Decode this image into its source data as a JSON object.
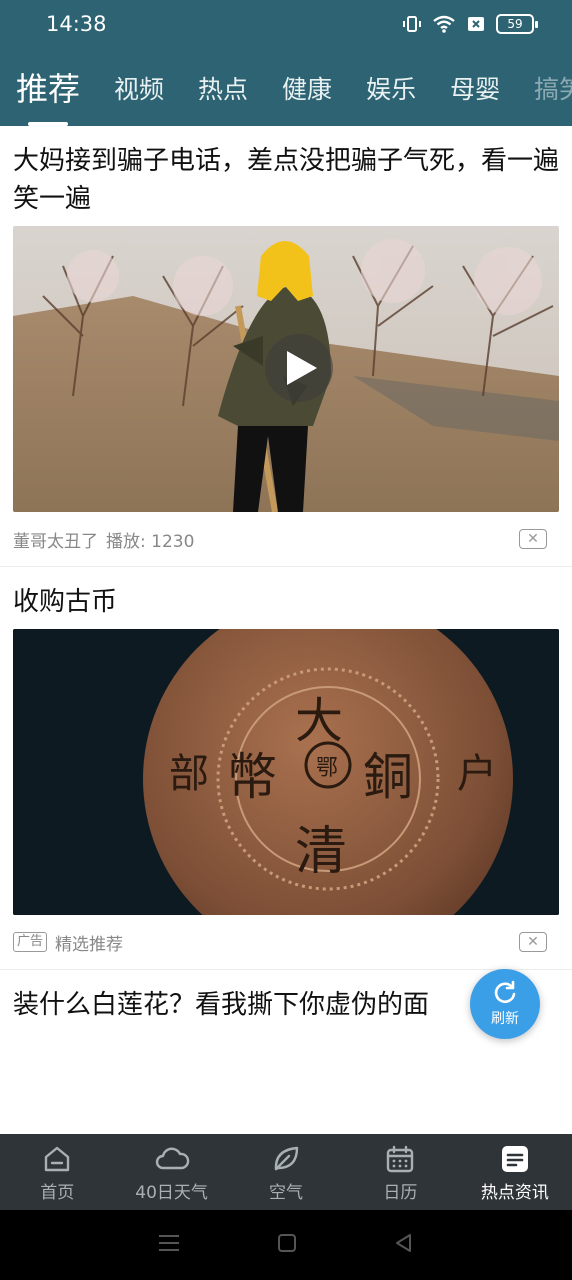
{
  "status_bar": {
    "time": "14:38",
    "battery": "59",
    "icons": [
      "vibrate-icon",
      "wifi-icon",
      "sim-off-icon",
      "battery-icon"
    ]
  },
  "tabs": [
    {
      "label": "推荐",
      "active": true
    },
    {
      "label": "视频"
    },
    {
      "label": "热点"
    },
    {
      "label": "健康"
    },
    {
      "label": "娱乐"
    },
    {
      "label": "母婴"
    },
    {
      "label": "搞笑"
    }
  ],
  "feed": {
    "items": [
      {
        "title": "大妈接到骗子电话，差点没把骗子气死，看一遍笑一遍",
        "source": "董哥太丑了",
        "plays": "播放: 1230",
        "has_play": true,
        "close_label": "✕"
      },
      {
        "title": "收购古币",
        "ad_tag": "广告",
        "source": "精选推荐",
        "close_label": "✕",
        "coin_text": {
          "top": "大",
          "bottom": "清",
          "left": "幣",
          "right": "銅",
          "center": "鄂",
          "outer_left": "部",
          "outer_right": "户"
        }
      },
      {
        "title": "装什么白莲花？看我撕下你虚伪的面"
      }
    ]
  },
  "refresh_button": {
    "label": "刷新"
  },
  "bottom_nav": [
    {
      "label": "首页",
      "icon": "home-icon"
    },
    {
      "label": "40日天气",
      "icon": "cloud-icon"
    },
    {
      "label": "空气",
      "icon": "leaf-icon"
    },
    {
      "label": "日历",
      "icon": "calendar-icon"
    },
    {
      "label": "热点资讯",
      "icon": "news-icon",
      "active": true
    }
  ],
  "colors": {
    "header": "#2d6372",
    "bottom_nav": "#2f3438",
    "refresh": "#3b9fe8"
  }
}
